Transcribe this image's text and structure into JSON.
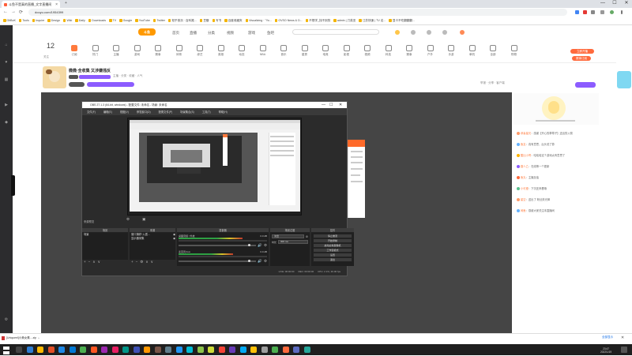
{
  "browser": {
    "tab_title": "斗鱼不是真的直播_文字直播间",
    "tab_close": "×",
    "newtab": "+",
    "url": "douyu.com/1954399",
    "window_controls": [
      "—",
      "☐",
      "✕"
    ],
    "nav": [
      "←",
      "→",
      "⟳"
    ]
  },
  "bookmarks": [
    "GitBoK",
    "Tools",
    "Inquire",
    "Design",
    "Wiki",
    "Daily",
    "Downloads",
    "TV",
    "Google",
    "YouTube",
    "Twitter",
    "知乎首页 · 百科推...",
    "豆瓣",
    "写书",
    "百度收藏夹",
    "Visualizing · \"Yo...",
    "OVSO News & D...",
    "不想学_找不到的",
    "admin | 刀英亚",
    "江苏快速 | TV 名...",
    "显卡不吃翻翻翻..."
  ],
  "site": {
    "logo": "斗鱼",
    "nav": [
      "首页",
      "直播",
      "分类",
      "视频",
      "游戏",
      "鱼吧",
      "直播"
    ],
    "header_big_number": "12",
    "header_big_number_label": "关注",
    "categories": [
      "订阅",
      "热门",
      "主播",
      "游戏",
      "赛事",
      "体育",
      "综艺",
      "英雄",
      "动态",
      "NBA",
      "音乐",
      "星秀",
      "电竞",
      "影视",
      "视频",
      "科技",
      "赛事",
      "户外",
      "手游",
      "单机",
      "全部",
      "购物"
    ],
    "pill_1": "立即开播",
    "pill_2": "赛事订阅",
    "room_title": "微微·全收集 又涉嫌违反",
    "room_small": "主播 · 分类 · 收藏 · 人气",
    "report": "举报 · 分享 · 客户端",
    "send_label": "发送"
  },
  "obs": {
    "title": "OBS 27.1.3 (64-bit, windows) - 配置文件: 未命名 - 场景: 未命名",
    "menu": [
      "文件(F)",
      "编辑(E)",
      "视图(V)",
      "停靠窗口(D)",
      "配置文件(P)",
      "场景集合(S)",
      "工具(T)",
      "帮助(H)"
    ],
    "preview_label": "来源预览",
    "scenes_header": "场景",
    "scene_item": "场景",
    "sources_header": "来源",
    "sources": [
      "窗口捕获·火狐...",
      "显示器采集"
    ],
    "mixer_header": "混音器",
    "mixer_channels": [
      {
        "name": "桌面音频 / 外放",
        "db": "0.0 dB",
        "level": 0.72
      },
      {
        "name": "麦克风/Aux",
        "db": "0.0 dB",
        "level": 0.62
      }
    ],
    "transitions_header": "场景过渡",
    "transition": "淡出",
    "duration_label": "时长",
    "duration": "300 ms",
    "controls_header": "控件",
    "controls": [
      "停止推流",
      "开始录制",
      "启动虚拟摄像机",
      "工作室模式",
      "设置",
      "退出"
    ],
    "status": [
      "LIVE: 00:00:00",
      "REC: 00:00:00",
      "CPU: 2.1%, 30.00 fps"
    ],
    "add_controls": [
      "+",
      "−",
      "∧",
      "∨"
    ],
    "panel_title_bar": [
      "—",
      "☐",
      "✕"
    ]
  },
  "chat": {
    "messages": [
      {
        "name": "恭喜星光",
        "text": "感谢【开心的草莓子】送出的火箭"
      },
      {
        "name": "鱼友",
        "text": "真有意思，后头说了算"
      },
      {
        "name": "酷比小哥",
        "text": "哈哈哈这个游戏太有意思了"
      },
      {
        "name": "路人乙",
        "text": "在线等一个更新"
      },
      {
        "name": "鱼丸",
        "text": "主播加油"
      },
      {
        "name": "小可爱",
        "text": "下次还来看哦"
      },
      {
        "name": "星空",
        "text": "送出了 粉丝荧光棒"
      },
      {
        "name": "闲鱼",
        "text": "感谢大家关注本直播间"
      }
    ]
  },
  "download": {
    "file": "[Uniqueel]小美女素....zip",
    "show_all": "全部显示",
    "close": "✕"
  },
  "taskbar": {
    "time": "23:47",
    "date": "2022/1/19"
  },
  "colors": {
    "brand_orange": "#ff6a3d",
    "purple": "#8c5cff",
    "obs_bg": "#2b2b2b"
  }
}
